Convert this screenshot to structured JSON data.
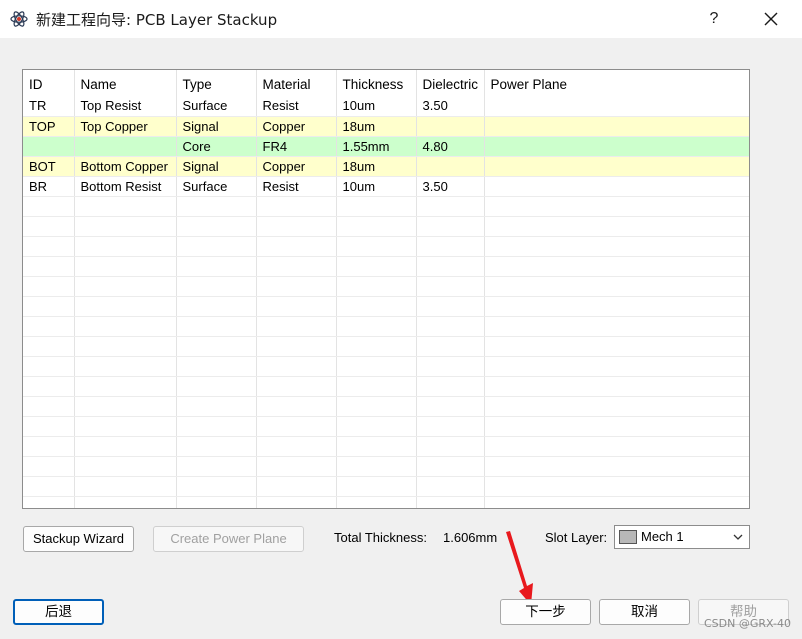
{
  "window": {
    "title": "新建工程向导: PCB Layer Stackup",
    "help_label": "?"
  },
  "grid": {
    "columns": [
      "ID",
      "Name",
      "Type",
      "Material",
      "Thickness",
      "Dielectric",
      "Power Plane"
    ],
    "rows": [
      {
        "id": "TR",
        "name": "Top Resist",
        "type": "Surface",
        "material": "Resist",
        "thickness": "10um",
        "dielectric": "3.50",
        "power_plane": "",
        "highlight": "none"
      },
      {
        "id": "TOP",
        "name": "Top Copper",
        "type": "Signal",
        "material": "Copper",
        "thickness": "18um",
        "dielectric": "",
        "power_plane": "",
        "highlight": "yellow"
      },
      {
        "id": "",
        "name": "",
        "type": "Core",
        "material": "FR4",
        "thickness": "1.55mm",
        "dielectric": "4.80",
        "power_plane": "",
        "highlight": "green"
      },
      {
        "id": "BOT",
        "name": "Bottom Copper",
        "type": "Signal",
        "material": "Copper",
        "thickness": "18um",
        "dielectric": "",
        "power_plane": "",
        "highlight": "yellow"
      },
      {
        "id": "BR",
        "name": "Bottom Resist",
        "type": "Surface",
        "material": "Resist",
        "thickness": "10um",
        "dielectric": "3.50",
        "power_plane": "",
        "highlight": "none"
      }
    ],
    "colors": {
      "yellow": "#ffffcc",
      "green": "#ccffcc"
    }
  },
  "controls": {
    "stackup_wizard_label": "Stackup Wizard",
    "create_power_plane_label": "Create Power Plane",
    "total_thickness_label": "Total Thickness:",
    "total_thickness_value": "1.606mm",
    "slot_layer_label": "Slot Layer:",
    "slot_layer_value": "Mech 1"
  },
  "footer": {
    "back_label": "后退",
    "next_label": "下一步",
    "cancel_label": "取消",
    "help_label": "帮助"
  },
  "watermark": "CSDN @GRX-40",
  "icons": {
    "app": "atom-icon",
    "close": "close-icon",
    "dropdown": "chevron-down-icon",
    "pointer": "red-arrow-annotation"
  },
  "accent": "#005fb8",
  "annotation_color": "#e8191d"
}
